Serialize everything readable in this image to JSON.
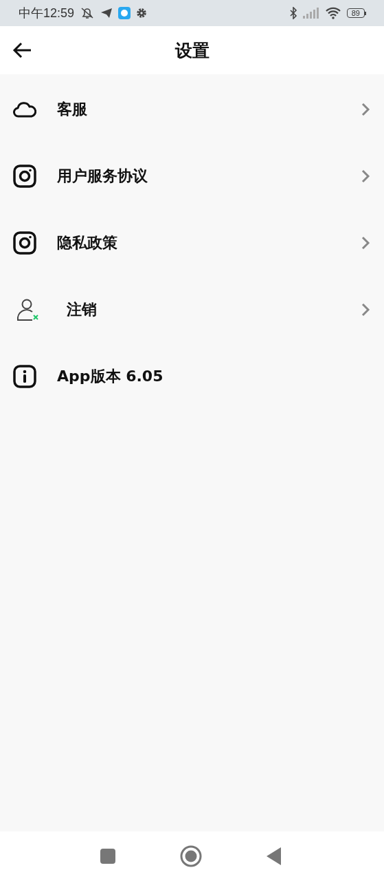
{
  "status_bar": {
    "time": "中午12:59",
    "battery": "89"
  },
  "header": {
    "title": "设置"
  },
  "items": [
    {
      "label": "客服",
      "kind": "cloud",
      "chevron": true
    },
    {
      "label": "用户服务协议",
      "kind": "camera",
      "chevron": true
    },
    {
      "label": "隐私政策",
      "kind": "camera",
      "chevron": true
    },
    {
      "label": "注销",
      "kind": "userx",
      "chevron": true
    },
    {
      "label": "App版本 6.05",
      "kind": "info",
      "chevron": false
    }
  ]
}
